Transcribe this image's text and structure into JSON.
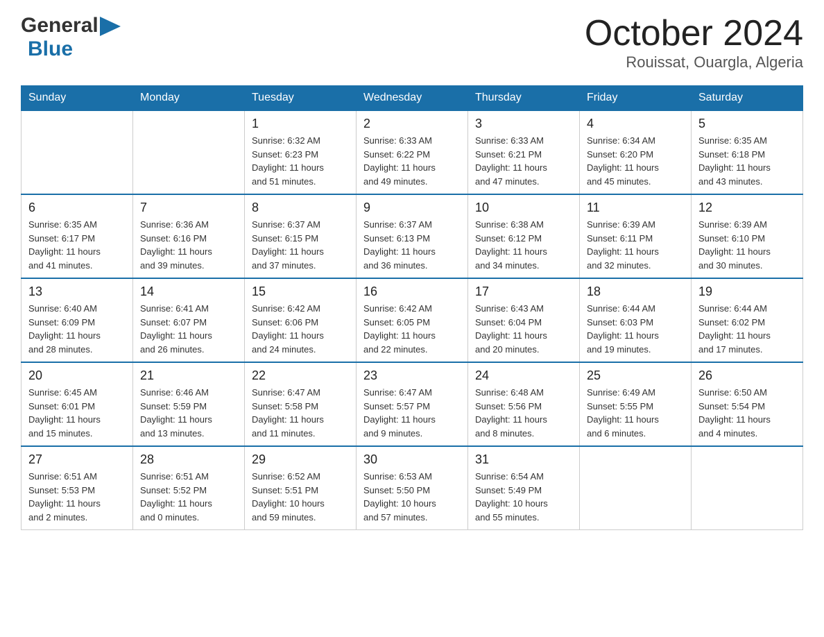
{
  "header": {
    "logo_general": "General",
    "logo_blue": "Blue",
    "title": "October 2024",
    "subtitle": "Rouissat, Ouargla, Algeria"
  },
  "days_of_week": [
    "Sunday",
    "Monday",
    "Tuesday",
    "Wednesday",
    "Thursday",
    "Friday",
    "Saturday"
  ],
  "weeks": [
    [
      {
        "day": "",
        "info": ""
      },
      {
        "day": "",
        "info": ""
      },
      {
        "day": "1",
        "info": "Sunrise: 6:32 AM\nSunset: 6:23 PM\nDaylight: 11 hours\nand 51 minutes."
      },
      {
        "day": "2",
        "info": "Sunrise: 6:33 AM\nSunset: 6:22 PM\nDaylight: 11 hours\nand 49 minutes."
      },
      {
        "day": "3",
        "info": "Sunrise: 6:33 AM\nSunset: 6:21 PM\nDaylight: 11 hours\nand 47 minutes."
      },
      {
        "day": "4",
        "info": "Sunrise: 6:34 AM\nSunset: 6:20 PM\nDaylight: 11 hours\nand 45 minutes."
      },
      {
        "day": "5",
        "info": "Sunrise: 6:35 AM\nSunset: 6:18 PM\nDaylight: 11 hours\nand 43 minutes."
      }
    ],
    [
      {
        "day": "6",
        "info": "Sunrise: 6:35 AM\nSunset: 6:17 PM\nDaylight: 11 hours\nand 41 minutes."
      },
      {
        "day": "7",
        "info": "Sunrise: 6:36 AM\nSunset: 6:16 PM\nDaylight: 11 hours\nand 39 minutes."
      },
      {
        "day": "8",
        "info": "Sunrise: 6:37 AM\nSunset: 6:15 PM\nDaylight: 11 hours\nand 37 minutes."
      },
      {
        "day": "9",
        "info": "Sunrise: 6:37 AM\nSunset: 6:13 PM\nDaylight: 11 hours\nand 36 minutes."
      },
      {
        "day": "10",
        "info": "Sunrise: 6:38 AM\nSunset: 6:12 PM\nDaylight: 11 hours\nand 34 minutes."
      },
      {
        "day": "11",
        "info": "Sunrise: 6:39 AM\nSunset: 6:11 PM\nDaylight: 11 hours\nand 32 minutes."
      },
      {
        "day": "12",
        "info": "Sunrise: 6:39 AM\nSunset: 6:10 PM\nDaylight: 11 hours\nand 30 minutes."
      }
    ],
    [
      {
        "day": "13",
        "info": "Sunrise: 6:40 AM\nSunset: 6:09 PM\nDaylight: 11 hours\nand 28 minutes."
      },
      {
        "day": "14",
        "info": "Sunrise: 6:41 AM\nSunset: 6:07 PM\nDaylight: 11 hours\nand 26 minutes."
      },
      {
        "day": "15",
        "info": "Sunrise: 6:42 AM\nSunset: 6:06 PM\nDaylight: 11 hours\nand 24 minutes."
      },
      {
        "day": "16",
        "info": "Sunrise: 6:42 AM\nSunset: 6:05 PM\nDaylight: 11 hours\nand 22 minutes."
      },
      {
        "day": "17",
        "info": "Sunrise: 6:43 AM\nSunset: 6:04 PM\nDaylight: 11 hours\nand 20 minutes."
      },
      {
        "day": "18",
        "info": "Sunrise: 6:44 AM\nSunset: 6:03 PM\nDaylight: 11 hours\nand 19 minutes."
      },
      {
        "day": "19",
        "info": "Sunrise: 6:44 AM\nSunset: 6:02 PM\nDaylight: 11 hours\nand 17 minutes."
      }
    ],
    [
      {
        "day": "20",
        "info": "Sunrise: 6:45 AM\nSunset: 6:01 PM\nDaylight: 11 hours\nand 15 minutes."
      },
      {
        "day": "21",
        "info": "Sunrise: 6:46 AM\nSunset: 5:59 PM\nDaylight: 11 hours\nand 13 minutes."
      },
      {
        "day": "22",
        "info": "Sunrise: 6:47 AM\nSunset: 5:58 PM\nDaylight: 11 hours\nand 11 minutes."
      },
      {
        "day": "23",
        "info": "Sunrise: 6:47 AM\nSunset: 5:57 PM\nDaylight: 11 hours\nand 9 minutes."
      },
      {
        "day": "24",
        "info": "Sunrise: 6:48 AM\nSunset: 5:56 PM\nDaylight: 11 hours\nand 8 minutes."
      },
      {
        "day": "25",
        "info": "Sunrise: 6:49 AM\nSunset: 5:55 PM\nDaylight: 11 hours\nand 6 minutes."
      },
      {
        "day": "26",
        "info": "Sunrise: 6:50 AM\nSunset: 5:54 PM\nDaylight: 11 hours\nand 4 minutes."
      }
    ],
    [
      {
        "day": "27",
        "info": "Sunrise: 6:51 AM\nSunset: 5:53 PM\nDaylight: 11 hours\nand 2 minutes."
      },
      {
        "day": "28",
        "info": "Sunrise: 6:51 AM\nSunset: 5:52 PM\nDaylight: 11 hours\nand 0 minutes."
      },
      {
        "day": "29",
        "info": "Sunrise: 6:52 AM\nSunset: 5:51 PM\nDaylight: 10 hours\nand 59 minutes."
      },
      {
        "day": "30",
        "info": "Sunrise: 6:53 AM\nSunset: 5:50 PM\nDaylight: 10 hours\nand 57 minutes."
      },
      {
        "day": "31",
        "info": "Sunrise: 6:54 AM\nSunset: 5:49 PM\nDaylight: 10 hours\nand 55 minutes."
      },
      {
        "day": "",
        "info": ""
      },
      {
        "day": "",
        "info": ""
      }
    ]
  ]
}
